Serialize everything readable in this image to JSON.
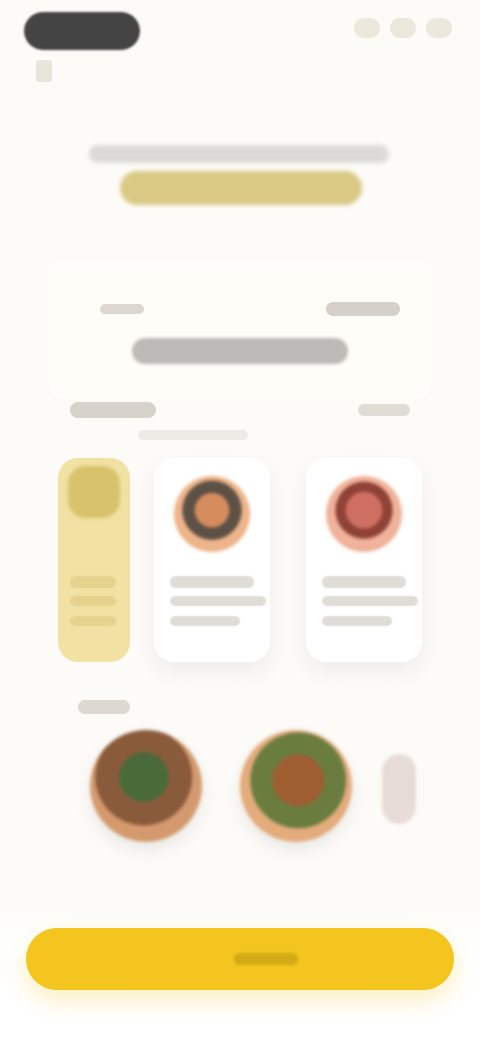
{
  "app": {
    "brand_color": "#f3c51e",
    "background": "#fcfbf7"
  },
  "icons": {
    "top_left": "logo",
    "top_right": "menu-dots",
    "hero_food": "food-image"
  }
}
